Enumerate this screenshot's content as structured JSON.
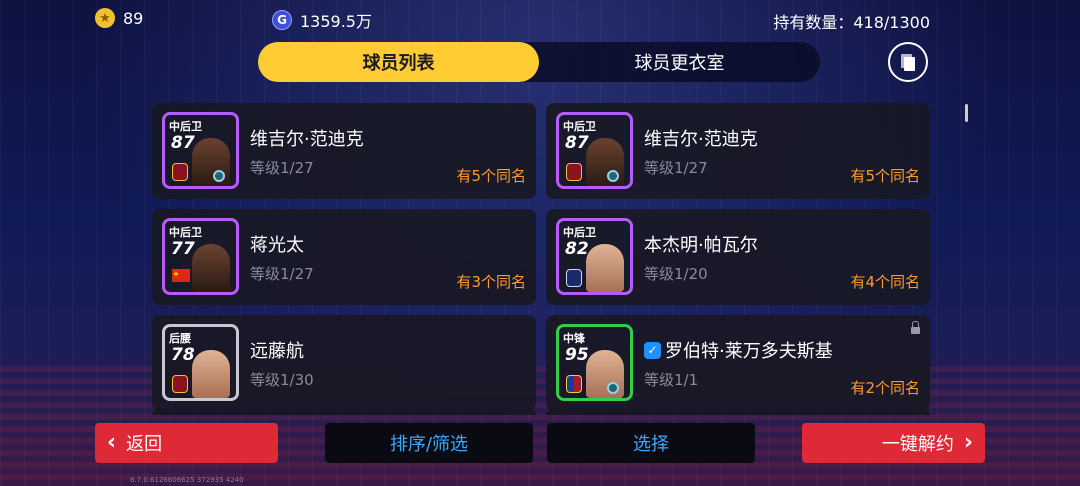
{
  "top": {
    "coins": "89",
    "gp": "1359.5万",
    "own_count": "持有数量：418/1300"
  },
  "tabs": [
    {
      "label": "球员列表",
      "active": true
    },
    {
      "label": "球员更衣室",
      "active": false
    }
  ],
  "players": [
    {
      "name": "维吉尔·范迪克",
      "level": "等级1/27",
      "dup": "有5个同名",
      "position": "中后卫",
      "rating": "87",
      "verified": false,
      "locked": false
    },
    {
      "name": "维吉尔·范迪克",
      "level": "等级1/27",
      "dup": "有5个同名",
      "position": "中后卫",
      "rating": "87",
      "verified": false,
      "locked": false
    },
    {
      "name": "蒋光太",
      "level": "等级1/27",
      "dup": "有3个同名",
      "position": "中后卫",
      "rating": "77",
      "verified": false,
      "locked": false
    },
    {
      "name": "本杰明·帕瓦尔",
      "level": "等级1/20",
      "dup": "有4个同名",
      "position": "中后卫",
      "rating": "82",
      "verified": false,
      "locked": false
    },
    {
      "name": "远藤航",
      "level": "等级1/30",
      "dup": "",
      "position": "后腰",
      "rating": "78",
      "verified": false,
      "locked": false
    },
    {
      "name": "罗伯特·莱万多夫斯基",
      "level": "等级1/1",
      "dup": "有2个同名",
      "position": "中锋",
      "rating": "95",
      "verified": true,
      "locked": true
    }
  ],
  "buttons": {
    "back": "返回",
    "sort": "排序/筛选",
    "select": "选择",
    "release": "一键解约"
  },
  "version": "8.7.0.6126606625 372935 4240",
  "icons": {
    "coin": "star-coin-icon",
    "gp": "gp-icon",
    "copy": "copy-icon",
    "back": "chevron-left-icon",
    "release": "chevron-right-icon"
  },
  "colors": {
    "tab_active": "#ffcc33",
    "accent_red": "#e02936",
    "dup_orange": "#ff9a2e",
    "link_blue": "#3aa8ff"
  }
}
